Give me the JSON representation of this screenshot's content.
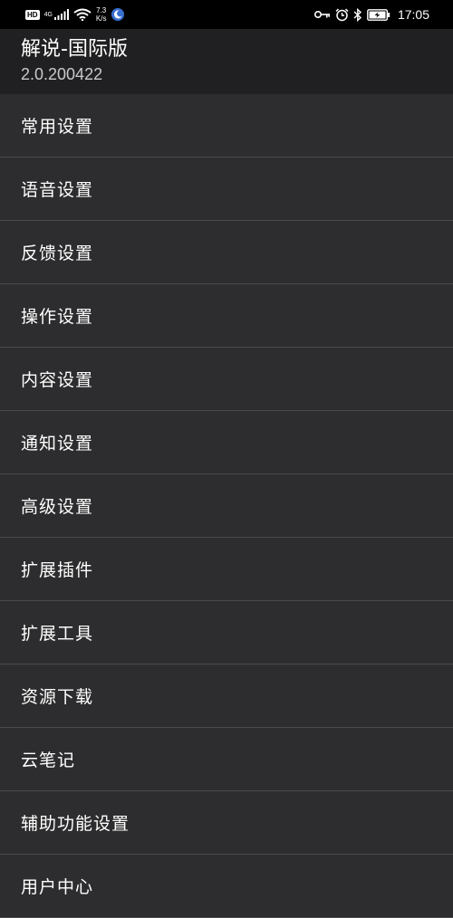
{
  "statusbar": {
    "hd_badge": "HD",
    "network_type": "4G",
    "speed_value": "7.3",
    "speed_unit": "K/s",
    "time": "17:05",
    "icons": [
      "signal-icon",
      "wifi-icon",
      "moon-icon",
      "key-icon",
      "alarm-icon",
      "bluetooth-icon",
      "battery-charging-icon"
    ]
  },
  "app": {
    "title": "解说-国际版",
    "version": "2.0.200422"
  },
  "menu": {
    "items": [
      {
        "label": "常用设置"
      },
      {
        "label": "语音设置"
      },
      {
        "label": "反馈设置"
      },
      {
        "label": "操作设置"
      },
      {
        "label": "内容设置"
      },
      {
        "label": "通知设置"
      },
      {
        "label": "高级设置"
      },
      {
        "label": "扩展插件"
      },
      {
        "label": "扩展工具"
      },
      {
        "label": "资源下载"
      },
      {
        "label": "云笔记"
      },
      {
        "label": "辅助功能设置"
      },
      {
        "label": "用户中心"
      }
    ]
  },
  "colors": {
    "background": "#2d2d2f",
    "appbar": "#202022",
    "statusbar": "#000000",
    "divider": "#4a4a4c",
    "text": "#ffffff",
    "subtext": "#c9c9c9"
  }
}
